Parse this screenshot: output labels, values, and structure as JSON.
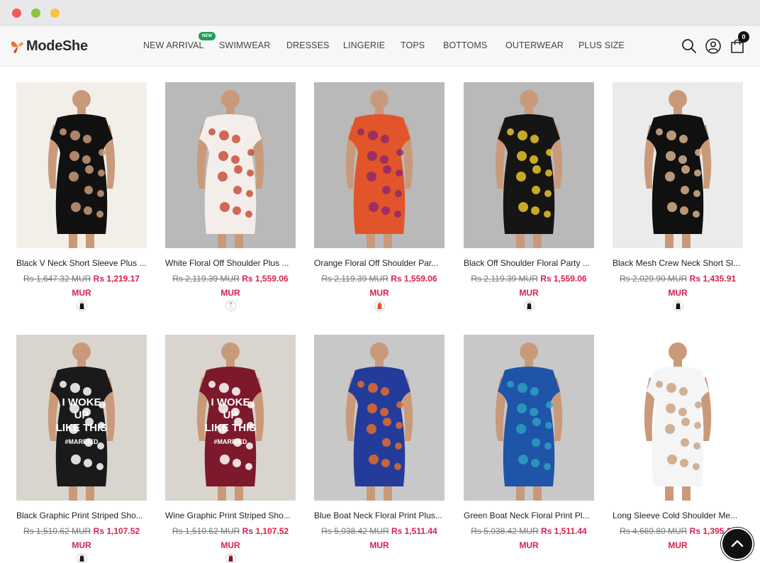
{
  "brand": {
    "name": "ModeShe"
  },
  "nav": {
    "items": [
      "NEW ARRIVAL",
      "SWIMWEAR",
      "DRESSES",
      "LINGERIE",
      "TOPS",
      "BOTTOMS",
      "OUTERWEAR",
      "PLUS SIZE"
    ],
    "new_badge": "NEW"
  },
  "header_icons": [
    "search-icon",
    "account-icon",
    "cart-icon"
  ],
  "cart": {
    "count": "0"
  },
  "currency_suffix": "MUR",
  "products": [
    {
      "name": "Black V Neck Short Sleeve Plus ...",
      "old_price": "Rs 1,647.32 MUR",
      "new_price": "Rs 1,219.17",
      "palette": [
        "#f2efe9",
        "#111111",
        "#c99a7a"
      ]
    },
    {
      "name": "White Floral Off Shoulder Plus ...",
      "old_price": "Rs 2,119.39 MUR",
      "new_price": "Rs 1,559.06",
      "palette": [
        "#b9b9b9",
        "#f3eeea",
        "#c8503c"
      ]
    },
    {
      "name": "Orange Floral Off Shoulder Par...",
      "old_price": "Rs 2,119.39 MUR",
      "new_price": "Rs 1,559.06",
      "palette": [
        "#b9b9b9",
        "#e2542a",
        "#8e2a6a"
      ]
    },
    {
      "name": "Black Off Shoulder Floral Party ...",
      "old_price": "Rs 2,119.39 MUR",
      "new_price": "Rs 1,559.06",
      "palette": [
        "#b9b9b9",
        "#151515",
        "#e8c32a"
      ]
    },
    {
      "name": "Black Mesh Crew Neck Short Sl...",
      "old_price": "Rs 2,029.90 MUR",
      "new_price": "Rs 1,435.91",
      "palette": [
        "#ebebeb",
        "#101010",
        "#d7b08c"
      ]
    },
    {
      "name": "Black Graphic Print Striped Sho...",
      "old_price": "Rs 1,510.62 MUR",
      "new_price": "Rs 1,107.52",
      "palette": [
        "#d9d5ce",
        "#1a1a1a",
        "#ffffff"
      ],
      "graphic": [
        "I WOKE",
        "UP",
        "LIKE THIS",
        "#MARRIED"
      ]
    },
    {
      "name": "Wine Graphic Print Striped Sho...",
      "old_price": "Rs 1,510.62 MUR",
      "new_price": "Rs 1,107.52",
      "palette": [
        "#d9d5ce",
        "#7c1a2b",
        "#ffffff"
      ],
      "graphic": [
        "I WOKE",
        "UP",
        "LIKE THIS",
        "#MARRIED"
      ]
    },
    {
      "name": "Blue Boat Neck Floral Print Plus...",
      "old_price": "Rs 5,038.42 MUR",
      "new_price": "Rs 1,511.44",
      "palette": [
        "#c8c8c8",
        "#233c9c",
        "#e36b2b"
      ]
    },
    {
      "name": "Green Boat Neck Floral Print Pl...",
      "old_price": "Rs 5,038.42 MUR",
      "new_price": "Rs 1,511.44",
      "palette": [
        "#c8c8c8",
        "#1e55a8",
        "#2da0c0"
      ]
    },
    {
      "name": "Long Sleeve Cold Shoulder Me...",
      "old_price": "Rs 4,669.80 MUR",
      "new_price": "Rs 1,395.27",
      "palette": [
        "#ffffff",
        "#f5f5f5",
        "#caa384"
      ]
    }
  ],
  "colors": {
    "accent": "#d6224f",
    "new_badge": "#1f9d55"
  }
}
